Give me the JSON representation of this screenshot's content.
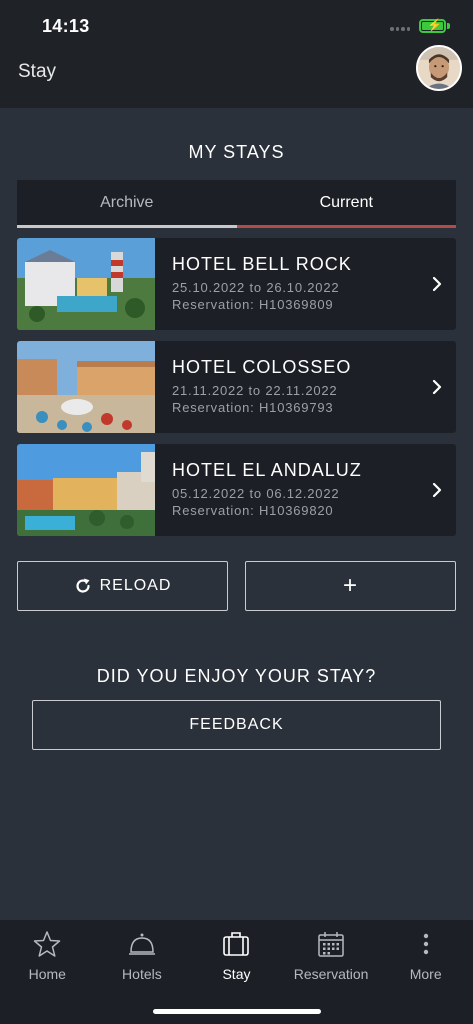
{
  "status_bar": {
    "time": "14:13"
  },
  "app_bar": {
    "title": "Stay"
  },
  "my_stays": {
    "title": "MY STAYS"
  },
  "tabs": [
    {
      "label": "Archive",
      "active": false
    },
    {
      "label": "Current",
      "active": true
    }
  ],
  "stays": [
    {
      "name": "HOTEL BELL ROCK",
      "dates": "25.10.2022 to 26.10.2022",
      "reservation": "Reservation: H10369809"
    },
    {
      "name": "HOTEL COLOSSEO",
      "dates": "21.11.2022 to 22.11.2022",
      "reservation": "Reservation: H10369793"
    },
    {
      "name": "HOTEL EL ANDALUZ",
      "dates": "05.12.2022 to 06.12.2022",
      "reservation": "Reservation: H10369820"
    }
  ],
  "actions": {
    "reload_label": "RELOAD",
    "add_label": "+"
  },
  "feedback": {
    "question": "DID YOU ENJOY YOUR STAY?",
    "button_label": "FEEDBACK"
  },
  "bottom_nav": [
    {
      "label": "Home",
      "icon": "star-icon",
      "active": false
    },
    {
      "label": "Hotels",
      "icon": "bell-icon",
      "active": false
    },
    {
      "label": "Stay",
      "icon": "suitcase-icon",
      "active": true
    },
    {
      "label": "Reservation",
      "icon": "calendar-icon",
      "active": false
    },
    {
      "label": "More",
      "icon": "more-icon",
      "active": false
    }
  ],
  "colors": {
    "background": "#2b313a",
    "bar": "#1f2328",
    "card": "#1c2026",
    "accent_red": "#b54a4a",
    "battery": "#3dc93d"
  }
}
